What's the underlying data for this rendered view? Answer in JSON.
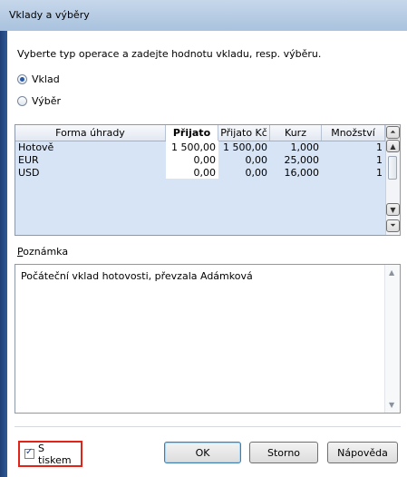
{
  "window": {
    "title": "Vklady a výběry"
  },
  "instruction": "Vyberte typ operace a zadejte hodnotu vkladu, resp. výběru.",
  "operation": {
    "options": [
      {
        "label": "Vklad",
        "selected": true
      },
      {
        "label": "Výběr",
        "selected": false
      }
    ]
  },
  "grid": {
    "columns": [
      "Forma úhrady",
      "Přijato",
      "Přijato Kč",
      "Kurz",
      "Množství"
    ],
    "rows": [
      [
        "Hotově",
        "1 500,00",
        "1 500,00",
        "1,000",
        "1"
      ],
      [
        "EUR",
        "0,00",
        "0,00",
        "25,000",
        "1"
      ],
      [
        "USD",
        "0,00",
        "0,00",
        "16,000",
        "1"
      ]
    ]
  },
  "note": {
    "label_hotkey": "P",
    "label_rest": "oznámka",
    "value": "Počáteční vklad hotovosti, převzala Adámková"
  },
  "print": {
    "label": "S tiskem",
    "checked": true
  },
  "buttons": {
    "ok": "OK",
    "cancel": "Storno",
    "help": "Nápověda"
  },
  "colors": {
    "highlight": "#e2231a",
    "grid_bg": "#d6e4f6"
  },
  "icons": {
    "scroll_top": "double-up-arrow",
    "scroll_up": "up-arrow",
    "scroll_down": "down-arrow",
    "scroll_bottom": "double-down-arrow"
  }
}
